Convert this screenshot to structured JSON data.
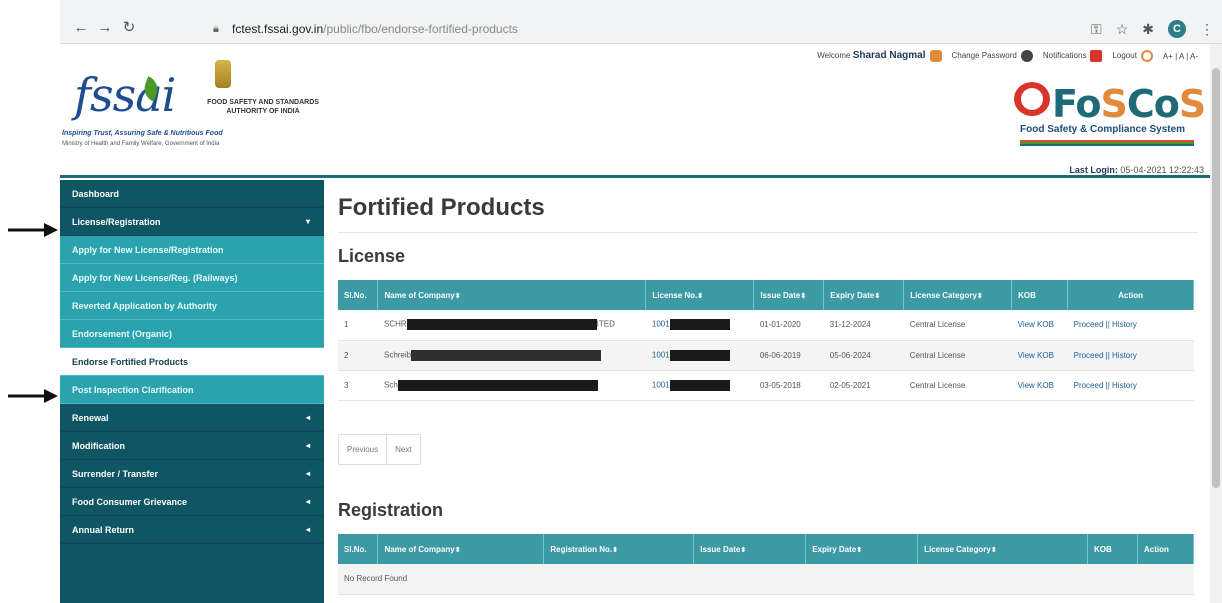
{
  "browser": {
    "host": "fctest.fssai.gov.in",
    "path": "/public/fbo/endorse-fortified-products"
  },
  "header": {
    "logo_text": "fssai",
    "authority_line1": "FOOD SAFETY AND STANDARDS",
    "authority_line2": "AUTHORITY OF INDIA",
    "tagline": "Inspiring Trust, Assuring Safe & Nutritious Food",
    "ministry": "Ministry of Health and Family Welfare, Government of India",
    "welcome_label": "Welcome",
    "user_name": "Sharad Nagmal",
    "change_password": "Change Password",
    "notifications": "Notifications",
    "logout": "Logout",
    "font_sizes": "A+ | A | A-",
    "brand_fo": "Fo",
    "brand_s1": "S",
    "brand_co": "Co",
    "brand_s2": "S",
    "brand_sub": "Food Safety & Compliance System",
    "last_login_label": "Last Login:",
    "last_login_value": "05-04-2021 12:22:43"
  },
  "sidebar": {
    "items": [
      {
        "label": "Dashboard"
      },
      {
        "label": "License/Registration",
        "caret": "▾"
      },
      {
        "label": "Apply for New License/Registration"
      },
      {
        "label": "Apply for New License/Reg. (Railways)"
      },
      {
        "label": "Reverted Application by Authority"
      },
      {
        "label": "Endorsement (Organic)"
      },
      {
        "label": "Endorse Fortified Products"
      },
      {
        "label": "Post Inspection Clarification"
      },
      {
        "label": "Renewal",
        "caret": "◂"
      },
      {
        "label": "Modification",
        "caret": "◂"
      },
      {
        "label": "Surrender / Transfer",
        "caret": "◂"
      },
      {
        "label": "Food Consumer Grievance",
        "caret": "◂"
      },
      {
        "label": "Annual Return",
        "caret": "◂"
      }
    ]
  },
  "main": {
    "page_title": "Fortified Products",
    "license_title": "License",
    "license_headers": [
      "Sl.No.",
      "Name of Company",
      "License No.",
      "Issue Date",
      "Expiry Date",
      "License Category",
      "KOB",
      "Action"
    ],
    "license_rows": [
      {
        "sl": "1",
        "company_start": "SCHR",
        "company_end": "ITED",
        "license_prefix": "1001",
        "issue": "01-01-2020",
        "expiry": "31-12-2024",
        "category": "Central License",
        "kob": "View KOB",
        "proceed": "Proceed",
        "sep": "||",
        "history": "History"
      },
      {
        "sl": "2",
        "company_start": "Schreib",
        "company_end": "",
        "license_prefix": "1001",
        "issue": "06-06-2019",
        "expiry": "05-06-2024",
        "category": "Central License",
        "kob": "View KOB",
        "proceed": "Proceed",
        "sep": "||",
        "history": "History"
      },
      {
        "sl": "3",
        "company_start": "Sch",
        "company_end": "",
        "license_prefix": "1001",
        "issue": "03-05-2018",
        "expiry": "02-05-2021",
        "category": "Central License",
        "kob": "View KOB",
        "proceed": "Proceed",
        "sep": "||",
        "history": "History"
      }
    ],
    "pager_prev": "Previous",
    "pager_next": "Next",
    "registration_title": "Registration",
    "registration_headers": [
      "Sl.No.",
      "Name of Company",
      "Registration No.",
      "Issue Date",
      "Expiry Date",
      "License Category",
      "KOB",
      "Action"
    ],
    "registration_empty": "No Record Found"
  },
  "colors": {
    "sidebar_dark": "#0f5563",
    "sidebar_sub": "#2aa3ae",
    "table_header": "#3c9aa5",
    "accent_red": "#d9342b"
  }
}
